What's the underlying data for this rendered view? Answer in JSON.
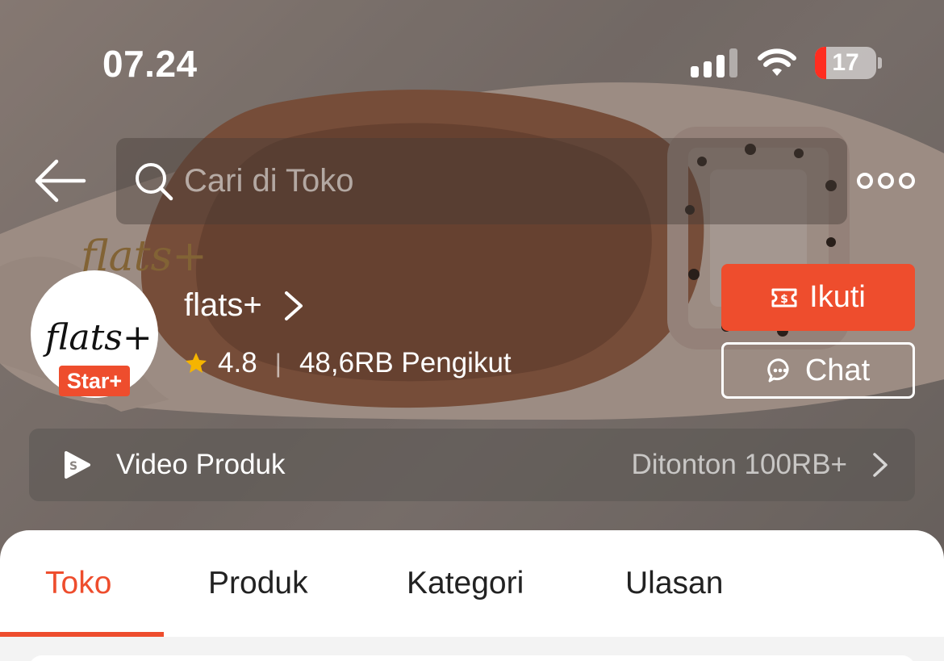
{
  "status_bar": {
    "time": "07.24",
    "battery": "17",
    "icons": [
      "signal-icon",
      "wifi-icon",
      "battery-icon"
    ]
  },
  "header": {
    "search_placeholder": "Cari di Toko",
    "icons": [
      "back-arrow-icon",
      "search-icon",
      "more-icon"
    ]
  },
  "shop": {
    "name": "flats+",
    "avatar_text": "flats+",
    "badge": "Star+",
    "rating": "4.8",
    "separator": "|",
    "followers": "48,6RB Pengikut",
    "follow_label": "Ikuti",
    "chat_label": "Chat"
  },
  "video": {
    "label": "Video Produk",
    "views": "Ditonton 100RB+"
  },
  "tabs": [
    {
      "label": "Toko",
      "active": true
    },
    {
      "label": "Produk",
      "active": false
    },
    {
      "label": "Kategori",
      "active": false
    },
    {
      "label": "Ulasan",
      "active": false
    }
  ],
  "colors": {
    "accent": "#ee4d2d",
    "star": "#f5b400",
    "battery_low": "#ff2d20"
  }
}
